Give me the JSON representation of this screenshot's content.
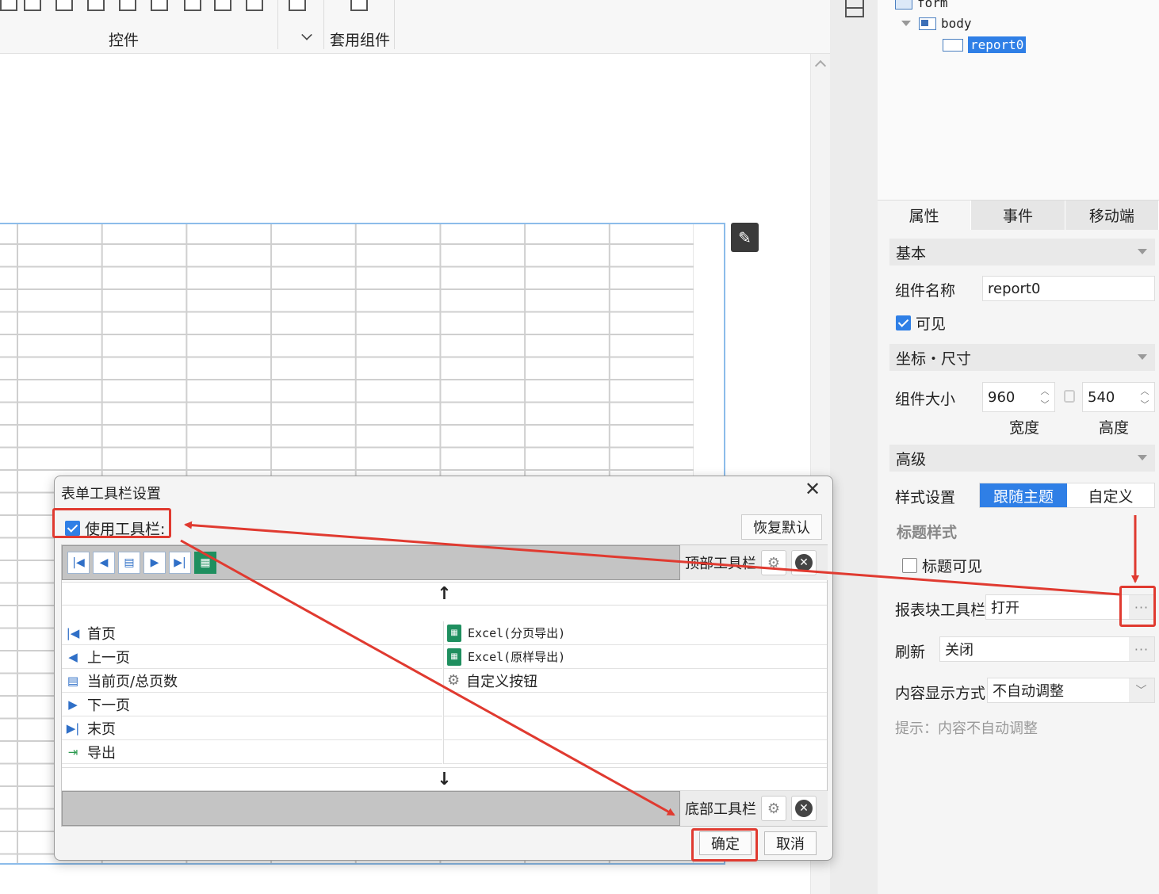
{
  "toolbar": {
    "controls_label": "控件",
    "widgets_label": "套用组件"
  },
  "tree": {
    "form": "form",
    "body": "body",
    "report": "report0"
  },
  "tabs": [
    "属性",
    "事件",
    "移动端"
  ],
  "props": {
    "basic_header": "基本",
    "name_label": "组件名称",
    "name_value": "report0",
    "visible_label": "可见",
    "position_header": "坐标・尺寸",
    "size_label": "组件大小",
    "width_value": "960",
    "height_value": "540",
    "width_caption": "宽度",
    "height_caption": "高度",
    "advanced_header": "高级",
    "style_label": "样式设置",
    "style_options": [
      "跟随主题",
      "自定义"
    ],
    "style_selected": "跟随主题",
    "title_style_label": "标题样式",
    "title_visible_label": "标题可见",
    "report_toolbar_label": "报表块工具栏",
    "report_toolbar_value": "打开",
    "refresh_label": "刷新",
    "refresh_value": "关闭",
    "content_mode_label": "内容显示方式",
    "content_mode_value": "不自动调整",
    "hint": "提示：内容不自动调整",
    "ellipsis": "···"
  },
  "dialog": {
    "title": "表单工具栏设置",
    "close_glyph": "✕",
    "use_toolbar_label": "使用工具栏:",
    "restore_label": "恢复默认",
    "top_toolbar_label": "顶部工具栏",
    "bottom_toolbar_label": "底部工具栏",
    "up_arrow": "↑",
    "down_arrow": "↓",
    "left_items": [
      "首页",
      "上一页",
      "当前页/总页数",
      "下一页",
      "末页",
      "导出"
    ],
    "right_items": [
      "Excel(分页导出)",
      "Excel(原样导出)",
      "自定义按钮"
    ],
    "ok_label": "确定",
    "cancel_label": "取消"
  },
  "colors": {
    "accent_blue": "#2f7fe6",
    "annotation_red": "#e03a30"
  }
}
